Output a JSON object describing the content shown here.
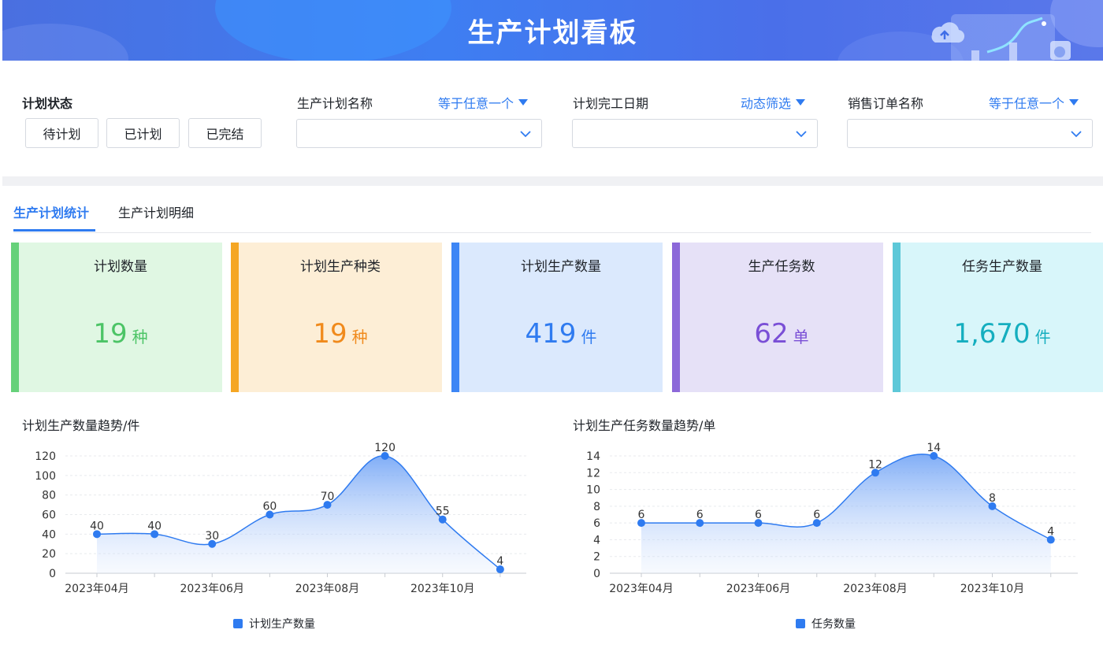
{
  "header": {
    "title": "生产计划看板"
  },
  "filters": {
    "status": {
      "label": "计划状态",
      "buttons": [
        "待计划",
        "已计划",
        "已完结"
      ]
    },
    "plan_name": {
      "label": "生产计划名称",
      "operator": "等于任意一个"
    },
    "finish_date": {
      "label": "计划完工日期",
      "operator": "动态筛选"
    },
    "order_name": {
      "label": "销售订单名称",
      "operator": "等于任意一个"
    }
  },
  "tabs": [
    {
      "label": "生产计划统计",
      "active": true
    },
    {
      "label": "生产计划明细",
      "active": false
    }
  ],
  "cards": [
    {
      "title": "计划数量",
      "value": "19",
      "unit": "种",
      "color": "#4cc466",
      "bg": "#e0f7e3",
      "bar": "#66d17a"
    },
    {
      "title": "计划生产种类",
      "value": "19",
      "unit": "种",
      "color": "#f08a1c",
      "bg": "#fdeed6",
      "bar": "#f5a623"
    },
    {
      "title": "计划生产数量",
      "value": "419",
      "unit": "件",
      "color": "#2f7bf0",
      "bg": "#dbe9fd",
      "bar": "#3d86f5"
    },
    {
      "title": "生产任务数",
      "value": "62",
      "unit": "单",
      "color": "#7a4fd6",
      "bg": "#e6e1f7",
      "bar": "#8c68d9"
    },
    {
      "title": "任务生产数量",
      "value": "1,670",
      "unit": "件",
      "color": "#15aebf",
      "bg": "#d8f6fa",
      "bar": "#5dc8d8"
    }
  ],
  "chart_data": [
    {
      "type": "area",
      "title": "计划生产数量趋势/件",
      "x": [
        "2023年04月",
        "2023年05月",
        "2023年06月",
        "2023年07月",
        "2023年08月",
        "2023年09月",
        "2023年10月",
        "2023年11月"
      ],
      "tick_labels": [
        "2023年04月",
        "2023年06月",
        "2023年08月",
        "2023年10月"
      ],
      "series": [
        {
          "name": "计划生产数量",
          "values": [
            40,
            40,
            30,
            60,
            70,
            120,
            55,
            4
          ]
        }
      ],
      "yticks": [
        0,
        20,
        40,
        60,
        80,
        100,
        120
      ],
      "ylim": [
        0,
        120
      ],
      "color": "#2f7bf0"
    },
    {
      "type": "area",
      "title": "计划生产任务数量趋势/单",
      "x": [
        "2023年04月",
        "2023年05月",
        "2023年06月",
        "2023年07月",
        "2023年08月",
        "2023年09月",
        "2023年10月",
        "2023年11月"
      ],
      "tick_labels": [
        "2023年04月",
        "2023年06月",
        "2023年08月",
        "2023年10月"
      ],
      "series": [
        {
          "name": "任务数量",
          "values": [
            6,
            6,
            6,
            6,
            12,
            14,
            8,
            4
          ]
        }
      ],
      "yticks": [
        0,
        2,
        4,
        6,
        8,
        10,
        12,
        14
      ],
      "ylim": [
        0,
        14
      ],
      "color": "#2f7bf0"
    }
  ]
}
